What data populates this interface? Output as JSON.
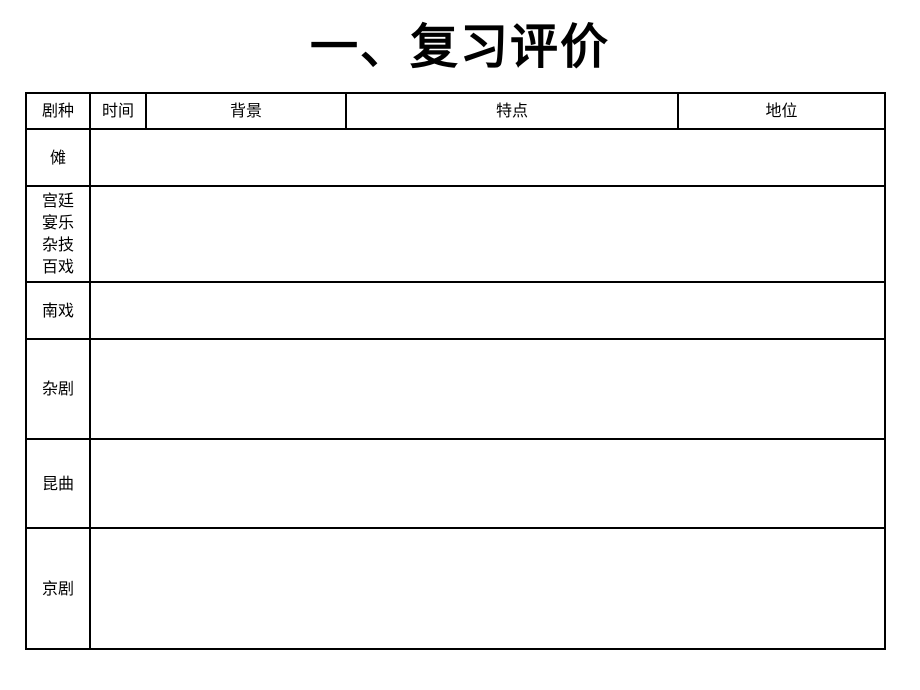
{
  "title": "一、复习评价",
  "table": {
    "headers": [
      "剧种",
      "时间",
      "背景",
      "特点",
      "地位"
    ],
    "rows": [
      {
        "label": "傩"
      },
      {
        "label_lines": [
          "宫廷",
          "宴乐",
          "杂技",
          "百戏"
        ]
      },
      {
        "label": "南戏"
      },
      {
        "label": "杂剧"
      },
      {
        "label": "昆曲"
      },
      {
        "label": "京剧"
      }
    ]
  }
}
